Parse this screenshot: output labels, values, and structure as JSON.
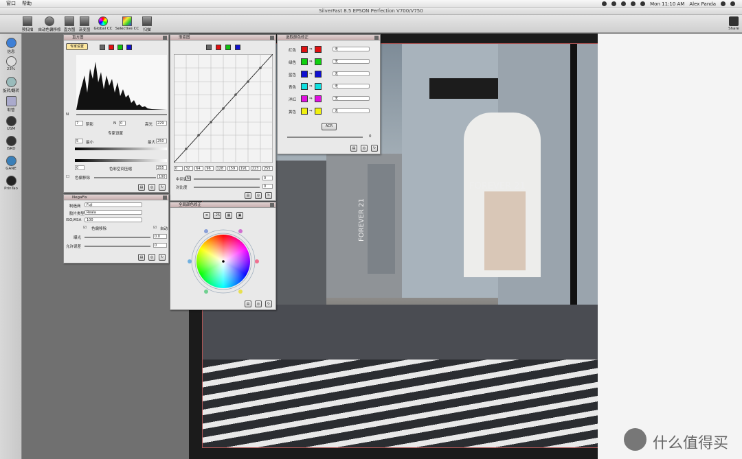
{
  "menubar": {
    "items": [
      "窗口",
      "帮助"
    ],
    "clock": "Mon 11:10 AM",
    "user": "Alex Panda"
  },
  "window": {
    "title": "SilverFast 8.5 EPSON Perfection V700/V750"
  },
  "toolbar": {
    "items": [
      "预扫描",
      "自动色偏移修",
      "直方图",
      "渐变图",
      "Global CC",
      "Selective CC",
      "扫描"
    ],
    "share": "Share"
  },
  "sidebar": {
    "items": [
      "信息",
      "23%",
      "旋转/翻转",
      "取管",
      "USM",
      "iSRD",
      "GANE",
      "PrinTao"
    ]
  },
  "histogram": {
    "title": "直方图",
    "expert_btn": "专家设置",
    "shadow_val": "7",
    "shadow_label": "阴影",
    "n_label": "N",
    "n_val": "0",
    "highlight_label": "高光",
    "highlight_val": "229",
    "expert_settings": "专家设置",
    "min_val": "5",
    "min_label": "最小",
    "max_label": "最大",
    "max_val": "250",
    "compress_label": "色彩空间压缩",
    "compress_min": "0",
    "compress_max": "255",
    "cast_label": "色偏移除",
    "cast_val": "100"
  },
  "gradation": {
    "title": "渐变图",
    "ticks": [
      "0",
      "32",
      "64",
      "96",
      "128",
      "159",
      "191",
      "223",
      "255"
    ],
    "mid_label": "中间调",
    "mid_val": "0",
    "contrast_label": "对比度",
    "contrast_val": "0"
  },
  "selective": {
    "title": "选取颜色修正",
    "rows": [
      {
        "label": "红色",
        "color": "#e01010",
        "val": "无"
      },
      {
        "label": "绿色",
        "color": "#10d010",
        "val": "无"
      },
      {
        "label": "蓝色",
        "color": "#1010d0",
        "val": "无"
      },
      {
        "label": "青色",
        "color": "#10e0e0",
        "val": "无"
      },
      {
        "label": "洋红",
        "color": "#e010e0",
        "val": "无"
      },
      {
        "label": "黄色",
        "color": "#f0f010",
        "val": "无"
      }
    ],
    "acr": "ACR",
    "slider_val": "0"
  },
  "negafix": {
    "title": "NegaFix",
    "maker_label": "制造商",
    "maker": "Fuji",
    "film_label": "胶片类型",
    "film": "Reala",
    "iso_label": "ISO/ASA",
    "iso": "100",
    "cast_label": "色偏移除",
    "auto_label": "自动",
    "exposure_label": "曝光",
    "exposure_val": "0.0",
    "tolerance_label": "允许误差",
    "tolerance_val": "0"
  },
  "globalcc": {
    "title": "全局颜色修正",
    "val": "-25"
  },
  "photo": {
    "sign1": "FOREVER 21",
    "sign2": "FOREVER 21"
  },
  "watermark": {
    "text": "什么值得买"
  },
  "colors": {
    "accent": "#5b8ec7",
    "panel_header": "#c7aeae"
  }
}
